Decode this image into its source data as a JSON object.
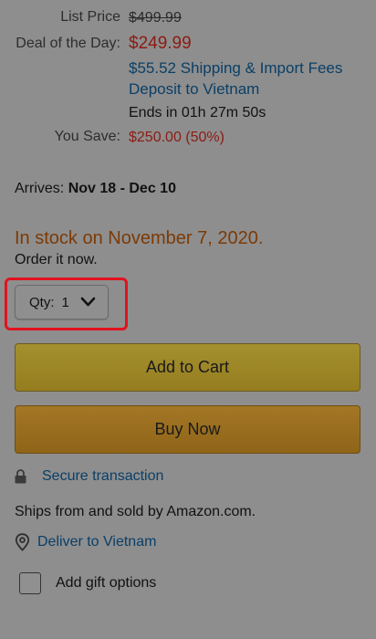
{
  "pricing": {
    "list_price_label": "List Price",
    "list_price_value": "$499.99",
    "deal_label": "Deal of the Day:",
    "deal_value": "$249.99",
    "shipping_line1": "$55.52 Shipping & Import Fees",
    "shipping_line2": "Deposit to Vietnam",
    "ends_in": "Ends in 01h 27m 50s",
    "you_save_label": "You Save:",
    "you_save_value": "$250.00 (50%)"
  },
  "arrival": {
    "label": "Arrives:",
    "dates": "Nov 18 - Dec 10"
  },
  "stock": {
    "status": "In stock on November 7, 2020.",
    "note": "Order it now."
  },
  "quantity": {
    "label": "Qty:",
    "value": "1"
  },
  "actions": {
    "add_to_cart": "Add to Cart",
    "buy_now": "Buy Now"
  },
  "secure": {
    "label": "Secure transaction",
    "icon": "lock-icon"
  },
  "shipping_info": "Ships from and sold by Amazon.com.",
  "deliver": {
    "label": "Deliver to Vietnam",
    "icon": "location-pin-icon"
  },
  "gift": {
    "label": "Add gift options"
  },
  "colors": {
    "price_red": "#8b1c12",
    "link_blue": "#0a3f66",
    "stock_orange": "#7c3a06",
    "highlight_red": "#e2121f",
    "add_to_cart_bg": "#a4902f",
    "buy_now_bg": "#a37725"
  }
}
